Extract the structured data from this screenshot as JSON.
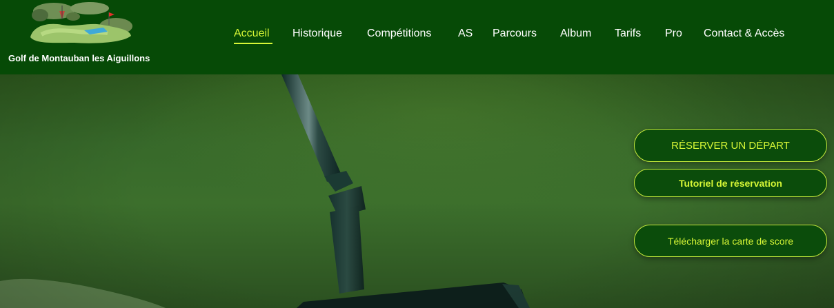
{
  "header": {
    "site_title": "Golf de Montauban les Aiguillons",
    "logo_icon": "golf-course-logo-icon"
  },
  "nav": {
    "items": [
      {
        "label": "Accueil",
        "active": true
      },
      {
        "label": "Historique",
        "active": false
      },
      {
        "label": "Compétitions",
        "active": false
      },
      {
        "label": "AS",
        "active": false
      },
      {
        "label": "Parcours",
        "active": false
      },
      {
        "label": "Album",
        "active": false
      },
      {
        "label": "Tarifs",
        "active": false
      },
      {
        "label": "Pro",
        "active": false
      },
      {
        "label": "Contact & Accès",
        "active": false
      }
    ]
  },
  "actions": {
    "reserve_label": "RÉSERVER UN DÉPART",
    "tutorial_label": "Tutoriel de réservation",
    "scorecard_label": "Télécharger la carte de score"
  },
  "colors": {
    "header_bg": "#064a06",
    "accent": "#d7f736",
    "button_bg": "#0b4c0b",
    "hero_green": "#37692a"
  }
}
